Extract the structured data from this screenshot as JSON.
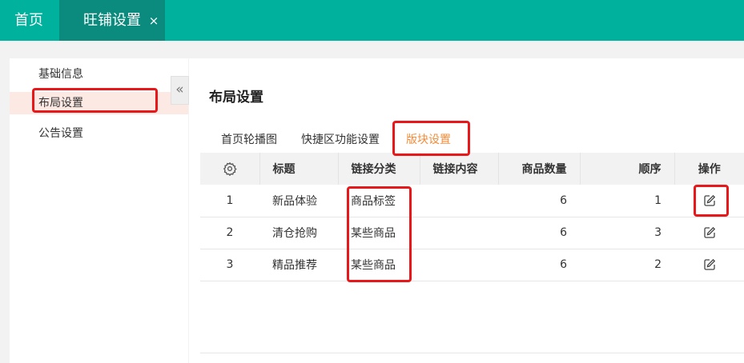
{
  "top_tabs": {
    "home": "首页",
    "active": "旺铺设置",
    "close": "×"
  },
  "sidebar": {
    "items": [
      "基础信息",
      "布局设置",
      "公告设置"
    ],
    "collapse_glyph": "«"
  },
  "main": {
    "title": "布局设置",
    "tabs": [
      "首页轮播图",
      "快捷区功能设置",
      "版块设置"
    ],
    "table": {
      "headers": [
        "标题",
        "链接分类",
        "链接内容",
        "商品数量",
        "顺序",
        "操作"
      ],
      "rows": [
        {
          "index": "1",
          "title": "新品体验",
          "category": "商品标签",
          "content": "",
          "quantity": "6",
          "order": "1"
        },
        {
          "index": "2",
          "title": "清仓抢购",
          "category": "某些商品",
          "content": "",
          "quantity": "6",
          "order": "3"
        },
        {
          "index": "3",
          "title": "精品推荐",
          "category": "某些商品",
          "content": "",
          "quantity": "6",
          "order": "2"
        }
      ]
    }
  },
  "colors": {
    "topbar": "#00b19d",
    "active_tab": "#0a8b7d",
    "accent_orange": "#f28c3a",
    "highlight_red": "#e8181a"
  },
  "icons": {
    "settings": "gear-icon",
    "edit": "edit-icon",
    "collapse": "double-chevron-left-icon"
  }
}
